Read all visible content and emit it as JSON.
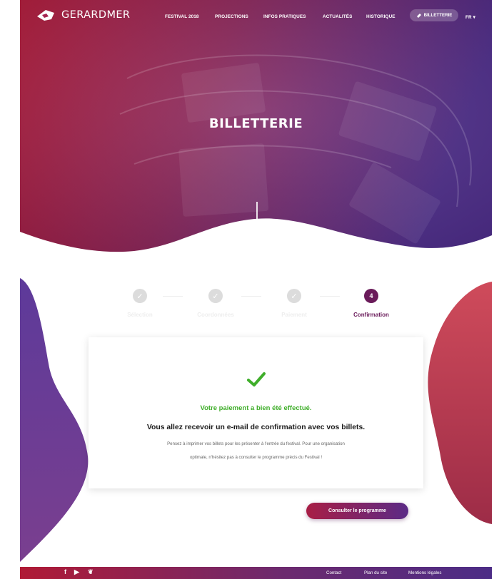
{
  "brand": {
    "logo_text": "GERARDMER"
  },
  "nav": {
    "items": [
      "FESTIVAL 2018",
      "PROJECTIONS",
      "INFOS PRATIQUES",
      "ACTUALITÉS",
      "HISTORIQUE"
    ],
    "ticket_button": "BILLETTERIE",
    "language": "FR ▾"
  },
  "hero": {
    "title": "BILLETTERIE"
  },
  "stepper": {
    "steps": [
      {
        "label": "Sélection",
        "status": "done"
      },
      {
        "label": "Coordonnées",
        "status": "done"
      },
      {
        "label": "Paiement",
        "status": "done"
      },
      {
        "label": "Confirmation",
        "status": "active",
        "number": "4"
      }
    ]
  },
  "confirmation": {
    "success": "Votre paiement a bien été effectué.",
    "headline": "Vous allez recevoir un e-mail de confirmation avec vos billets.",
    "body_line1": "Pensez à imprimer vos billets pour les présenter à l'entrée du festival. Pour une organisation",
    "body_line2": "optimale, n'hésitez pas à consulter le programme précis du Festival !"
  },
  "cta": {
    "label": "Consulter le programme"
  },
  "footer": {
    "social": [
      "facebook-icon",
      "youtube-icon",
      "twitter-icon"
    ],
    "links": [
      "Contact",
      "Plan du site",
      "Mentions légales"
    ]
  },
  "colors": {
    "accent_purple": "#6a1b5a",
    "success_green": "#3fae2a",
    "gradient_red": "#a81e45",
    "gradient_violet": "#5b2a86"
  }
}
